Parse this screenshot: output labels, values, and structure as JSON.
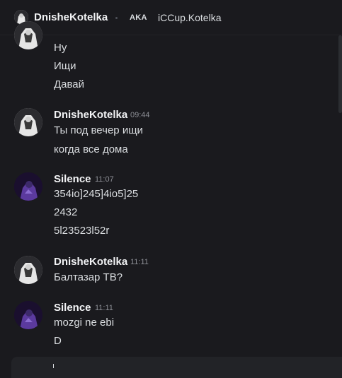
{
  "header": {
    "user_name": "DnisheKotelka",
    "aka_label": "AKA",
    "alias": "iCCup.Kotelka"
  },
  "messages": [
    {
      "lines": [
        "Ну",
        "Ищи",
        "Давай"
      ]
    },
    {
      "author": "DnisheKotelka",
      "time": "09:44",
      "lines": [
        "Ты под вечер ищи",
        "когда все дома"
      ]
    },
    {
      "author": "Silence",
      "time": "11:07",
      "lines": [
        "354io]245]4io5]25",
        "2432",
        "5l23523l52r"
      ]
    },
    {
      "author": "DnisheKotelka",
      "time": "11:11",
      "lines": [
        "Балтазар ТВ?"
      ]
    },
    {
      "author": "Silence",
      "time": "11:11",
      "lines": [
        "mozgi ne ebi",
        "D"
      ]
    }
  ],
  "colors": {
    "background": "#1a1a1e",
    "author_text": "#f2f3f5",
    "message_text": "#dbdee1",
    "timestamp": "#8d8f96"
  }
}
